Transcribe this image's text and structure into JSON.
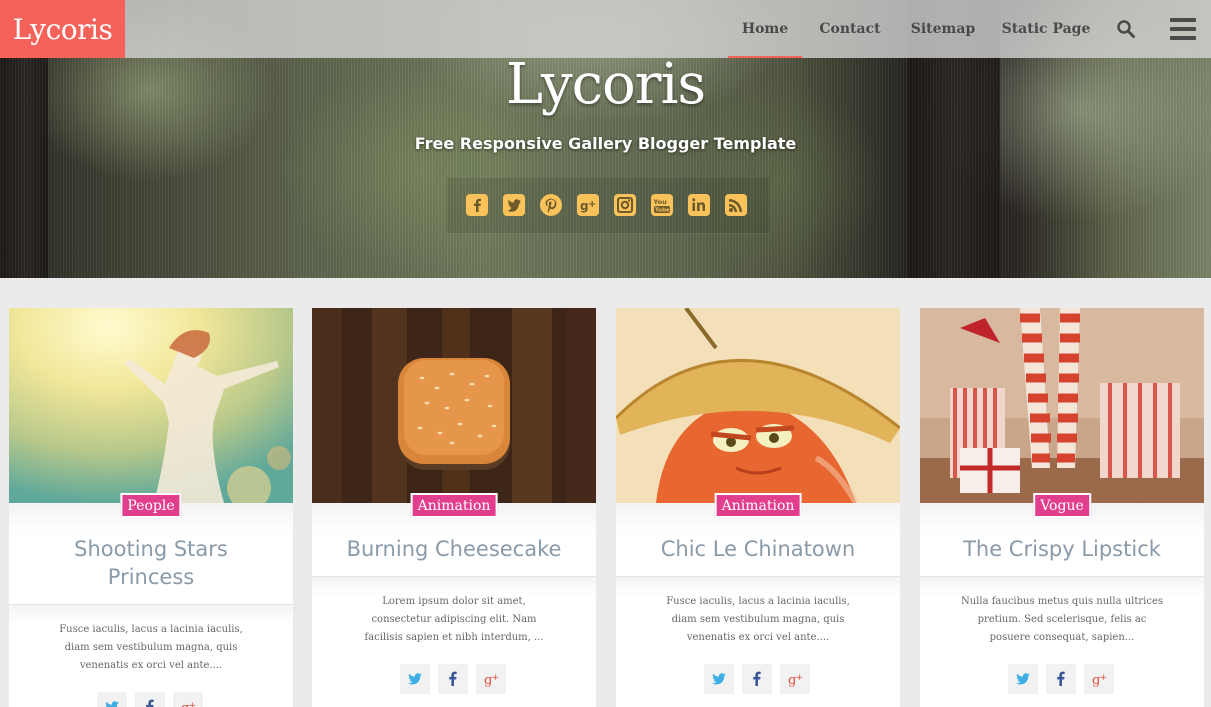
{
  "brand": {
    "logo": "Lycoris",
    "accent": "#f5625a",
    "tag_color": "#e23e8e"
  },
  "nav": {
    "items": [
      {
        "label": "Home",
        "active": true
      },
      {
        "label": "Contact",
        "active": false
      },
      {
        "label": "Sitemap",
        "active": false
      },
      {
        "label": "Static Page",
        "active": false
      }
    ],
    "icons": [
      "search-icon",
      "hamburger-menu-icon"
    ]
  },
  "hero": {
    "title": "Lycoris",
    "subtitle": "Free Responsive Gallery Blogger Template",
    "social": [
      "facebook-icon",
      "twitter-icon",
      "pinterest-icon",
      "google-plus-icon",
      "instagram-icon",
      "youtube-icon",
      "linkedin-icon",
      "rss-icon"
    ],
    "icon_color": "#f9c25a"
  },
  "posts": [
    {
      "tag": "People",
      "title": "Shooting Stars Princess",
      "excerpt": "Fusce iaculis, lacus a lacinia iaculis, diam sem vestibulum magna, quis venenatis ex orci vel ante....",
      "share": [
        "twitter-icon",
        "facebook-icon",
        "google-plus-icon"
      ]
    },
    {
      "tag": "Animation",
      "title": "Burning Cheesecake",
      "excerpt": "Lorem ipsum dolor sit amet, consectetur adipiscing elit. Nam facilisis sapien et nibh interdum, ...",
      "share": [
        "twitter-icon",
        "facebook-icon",
        "google-plus-icon"
      ]
    },
    {
      "tag": "Animation",
      "title": "Chic Le Chinatown",
      "excerpt": "Fusce iaculis, lacus a lacinia iaculis, diam sem vestibulum magna, quis venenatis ex orci vel ante....",
      "share": [
        "twitter-icon",
        "facebook-icon",
        "google-plus-icon"
      ]
    },
    {
      "tag": "Vogue",
      "title": "The Crispy Lipstick",
      "excerpt": "Nulla faucibus metus quis nulla ultrices pretium. Sed scelerisque, felis ac posuere consequat, sapien...",
      "share": [
        "twitter-icon",
        "facebook-icon",
        "google-plus-icon"
      ]
    }
  ]
}
